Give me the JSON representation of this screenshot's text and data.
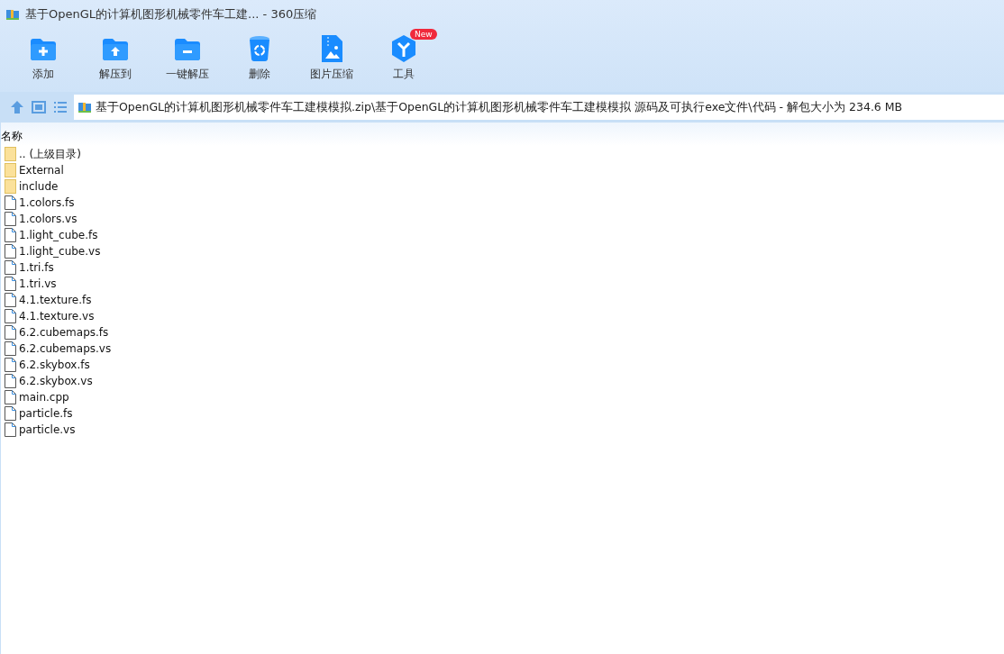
{
  "window": {
    "title": "基于OpenGL的计算机图形机械零件车工建... - 360压缩"
  },
  "toolbar": [
    {
      "kind": "add",
      "label": "添加"
    },
    {
      "kind": "extract-to",
      "label": "解压到"
    },
    {
      "kind": "extract",
      "label": "一键解压"
    },
    {
      "kind": "delete",
      "label": "删除"
    },
    {
      "kind": "image",
      "label": "图片压缩"
    },
    {
      "kind": "tools",
      "label": "工具",
      "badge": "New"
    }
  ],
  "address": {
    "path": "基于OpenGL的计算机图形机械零件车工建模模拟.zip\\基于OpenGL的计算机图形机械零件车工建模模拟 源码及可执行exe文件\\代码 - 解包大小为 234.6 MB"
  },
  "table": {
    "columns": [
      "名称"
    ],
    "rows": [
      {
        "kind": "folder",
        "name": ".. (上级目录)"
      },
      {
        "kind": "folder",
        "name": "External"
      },
      {
        "kind": "folder",
        "name": "include"
      },
      {
        "kind": "file",
        "name": "1.colors.fs"
      },
      {
        "kind": "file",
        "name": "1.colors.vs"
      },
      {
        "kind": "file",
        "name": "1.light_cube.fs"
      },
      {
        "kind": "file",
        "name": "1.light_cube.vs"
      },
      {
        "kind": "file",
        "name": "1.tri.fs"
      },
      {
        "kind": "file",
        "name": "1.tri.vs"
      },
      {
        "kind": "file",
        "name": "4.1.texture.fs"
      },
      {
        "kind": "file",
        "name": "4.1.texture.vs"
      },
      {
        "kind": "file",
        "name": "6.2.cubemaps.fs"
      },
      {
        "kind": "file",
        "name": "6.2.cubemaps.vs"
      },
      {
        "kind": "file",
        "name": "6.2.skybox.fs"
      },
      {
        "kind": "file",
        "name": "6.2.skybox.vs"
      },
      {
        "kind": "file",
        "name": "main.cpp"
      },
      {
        "kind": "file",
        "name": "particle.fs"
      },
      {
        "kind": "file",
        "name": "particle.vs"
      }
    ]
  }
}
